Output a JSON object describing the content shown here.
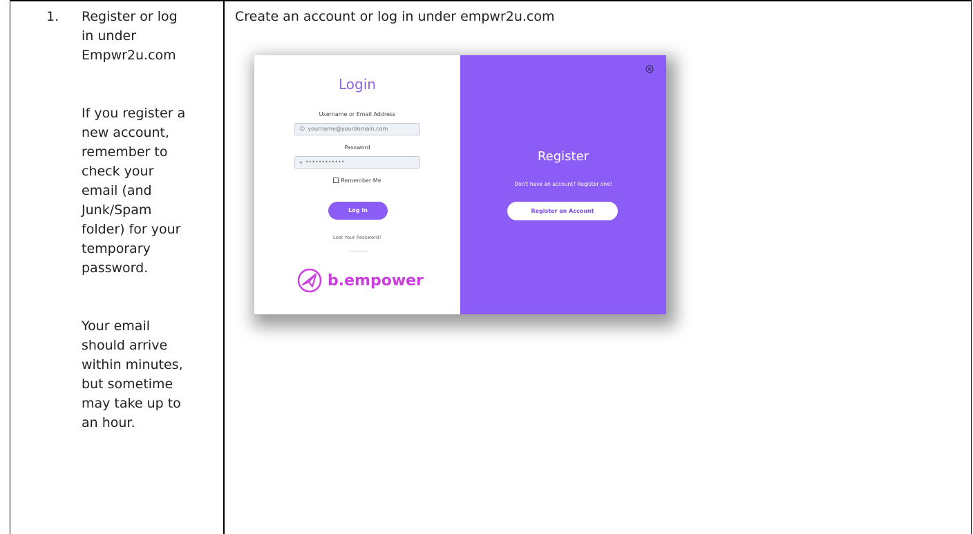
{
  "left_cell": {
    "number": "1.",
    "lead_lines": [
      "Register or log",
      "in under",
      "Empwr2u.com"
    ],
    "para1_lines": [
      "If you register a",
      "new account,",
      "remember to",
      "check your",
      "email (and",
      "Junk/Spam",
      "folder) for your",
      "temporary",
      "password."
    ],
    "para2_lines": [
      "Your email",
      "should arrive",
      "within minutes,",
      "but sometime",
      "may take up to",
      "an hour."
    ]
  },
  "right_cell": {
    "heading": "Create an account or log in under empwr2u.com"
  },
  "login_panel": {
    "title": "Login",
    "username_label": "Username or Email Address",
    "username_placeholder": "yourname@yourdomain.com",
    "password_label": "Password",
    "password_value": "••••••••••••",
    "remember_label": "Remember Me",
    "login_button": "Log In",
    "lost_password": "Lost Your Password?",
    "brand_name": "b.empower"
  },
  "register_panel": {
    "title": "Register",
    "subtitle": "Don't have an account? Register one!",
    "button": "Register an Account"
  },
  "colors": {
    "accent_purple": "#8c5cf6",
    "brand_magenta": "#cc3ee0",
    "title_purple": "#8e63e4"
  }
}
